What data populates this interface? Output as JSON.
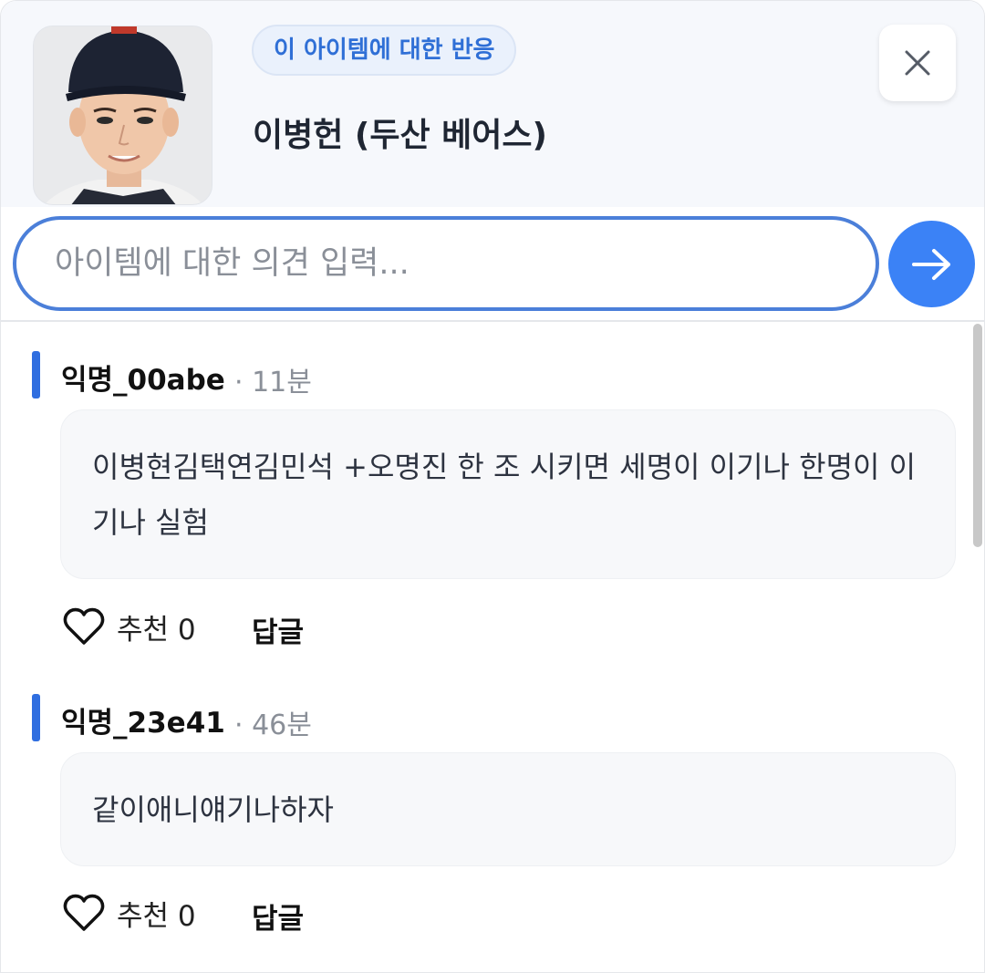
{
  "header": {
    "badge": "이 아이템에 대한 반응",
    "title": "이병헌 (두산 베어스)",
    "thumbnail": "player-portrait-image"
  },
  "input": {
    "placeholder": "아이템에 대한 의견 입력...",
    "value": ""
  },
  "icons": {
    "close": "close-icon",
    "send": "arrow-right-icon",
    "like": "heart-outline-icon"
  },
  "colors": {
    "accent": "#2f6ee0",
    "send_button": "#3b82f6",
    "badge_text": "#2f6fd6"
  },
  "comments": [
    {
      "author": "익명_00abe",
      "time": "· 11분",
      "text": "이병현김택연김민석 +오명진 한 조 시키면 세명이 이기나 한명이 이기나 실험",
      "like_label": "추천 0",
      "reply_label": "답글"
    },
    {
      "author": "익명_23e41",
      "time": "· 46분",
      "text": "같이애니얘기나하자",
      "like_label": "추천 0",
      "reply_label": "답글"
    }
  ]
}
